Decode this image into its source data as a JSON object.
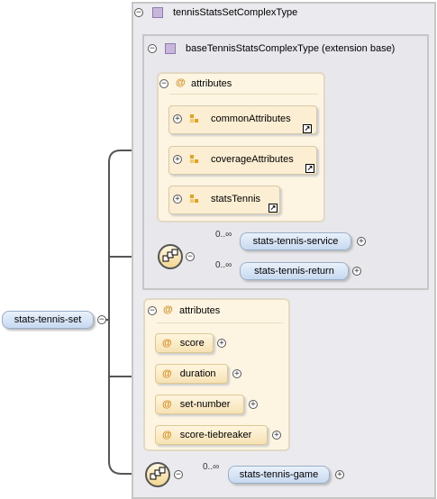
{
  "root": {
    "label": "stats-tennis-set"
  },
  "complex_type": {
    "label": "tennisStatsSetComplexType"
  },
  "base_type": {
    "label": "baseTennisStatsComplexType (extension base)"
  },
  "base_attributes": {
    "label": "attributes",
    "groups": [
      {
        "label": "commonAttributes"
      },
      {
        "label": "coverageAttributes"
      },
      {
        "label": "statsTennis"
      }
    ]
  },
  "base_sequence": {
    "elements": [
      {
        "label": "stats-tennis-service",
        "cardinality": "0..∞"
      },
      {
        "label": "stats-tennis-return",
        "cardinality": "0..∞"
      }
    ]
  },
  "own_attributes": {
    "label": "attributes",
    "items": [
      {
        "label": "score"
      },
      {
        "label": "duration"
      },
      {
        "label": "set-number"
      },
      {
        "label": "score-tiebreaker"
      }
    ]
  },
  "own_sequence": {
    "elements": [
      {
        "label": "stats-tennis-game",
        "cardinality": "0..∞"
      }
    ]
  },
  "glyphs": {
    "collapse": "−",
    "expand": "+",
    "attr_marker": "@",
    "link_arrow": "↗"
  }
}
